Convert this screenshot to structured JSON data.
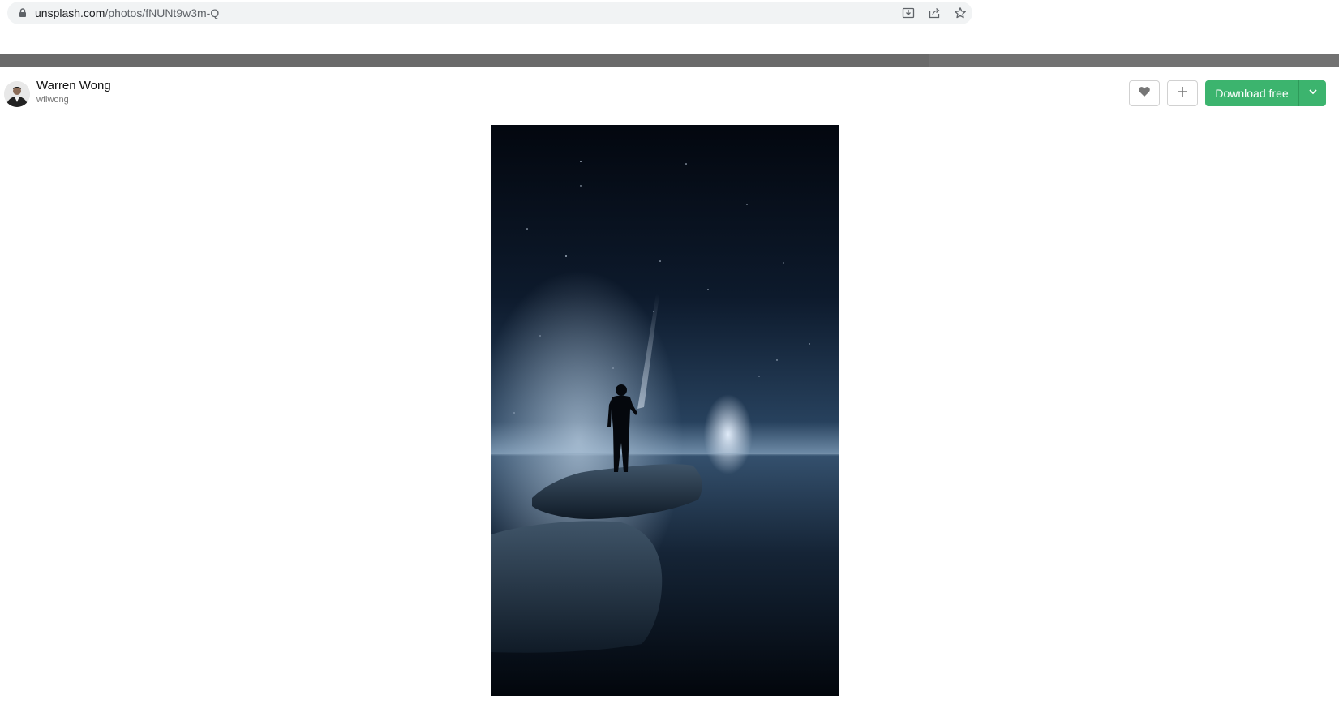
{
  "browser": {
    "url_domain": "unsplash.com",
    "url_path": "/photos/fNUNt9w3m-Q",
    "icons": [
      "lock-icon",
      "install-icon",
      "share-icon",
      "bookmark-star-icon"
    ]
  },
  "photo_header": {
    "author_name": "Warren Wong",
    "author_handle": "wflwong",
    "like_icon": "heart-icon",
    "add_icon": "plus-icon",
    "download_label": "Download free",
    "download_caret_icon": "chevron-down-icon"
  },
  "colors": {
    "download_green": "#3cb46e",
    "omnibox_bg": "#f1f3f4"
  },
  "photo": {
    "subject": "silhouette-with-flashlight-on-rock-night-sea"
  }
}
